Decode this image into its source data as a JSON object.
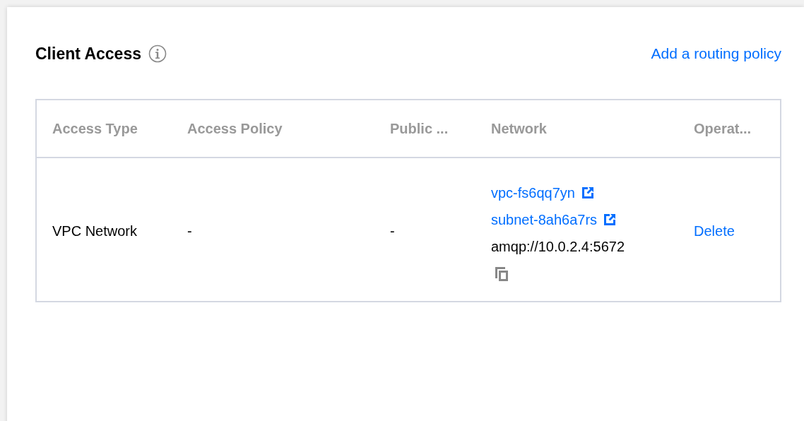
{
  "panel": {
    "title": "Client Access",
    "action_link": "Add a routing policy"
  },
  "table": {
    "columns": [
      "Access Type",
      "Access Policy",
      "Public ...",
      "Network",
      "Operat..."
    ],
    "rows": [
      {
        "access_type": "VPC Network",
        "access_policy": "-",
        "public": "-",
        "network": {
          "vpc": "vpc-fs6qq7yn",
          "subnet": "subnet-8ah6a7rs",
          "address": "amqp://10.0.2.4:5672"
        },
        "operation": "Delete"
      }
    ]
  }
}
